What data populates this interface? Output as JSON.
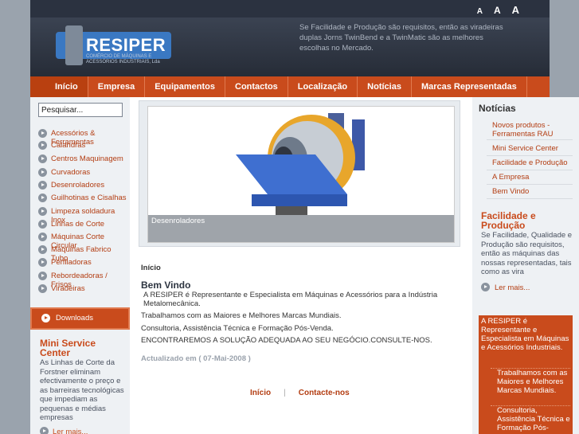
{
  "header": {
    "font_sizes": [
      "A",
      "A",
      "A"
    ],
    "logo_text": "RESIPER",
    "logo_sub": "COMÉRCIO DE MÁQUINAS E ACESSÓRIOS INDUSTRIAIS, Lda",
    "tagline": "Se Facilidade e Produção são requisitos, então as viradeiras duplas Jorns TwinBend e a TwinMatic são as melhores escolhas no Mercado."
  },
  "nav": [
    "Início",
    "Empresa",
    "Equipamentos",
    "Contactos",
    "Localização",
    "Notícias",
    "Marcas Representadas"
  ],
  "left": {
    "search_value": "Pesquisar...",
    "menu": [
      "Acessórios & Ferramentas",
      "Calandras",
      "Centros Maquinagem",
      "Curvadoras",
      "Desenroladores",
      "Guilhotinas e Cisalhas",
      "Limpeza soldadura Inox",
      "Linhas de Corte",
      "Máquinas Corte Circular",
      "Máquinas Fabrico Tubo",
      "Perfiladoras",
      "Rebordeadoras / Frisos",
      "Viradeiras"
    ],
    "downloads": "Downloads",
    "msc_title": "Mini Service Center",
    "msc_text": "As Linhas de Corte da Forstner eliminam efectivamente o preço e as barreiras tecnológicas que impediam as pequenas e médias empresas",
    "msc_more": "Ler mais..."
  },
  "center": {
    "banner_caption": "Desenroladores",
    "breadcrumb": "Início",
    "welcome_title": "Bem Vindo",
    "welcome_paragraphs": [
      "A RESIPER é Representante e Especialista em Máquinas e Acessórios para a Indústria Metalomecânica.",
      "Trabalhamos com as Maiores e Melhores Marcas Mundiais.",
      "Consultoria, Assistência Técnica e Formação Pós-Venda.",
      "ENCONTRAREMOS A SOLUÇÃO ADEQUADA AO SEU NEGÓCIO.CONSULTE-NOS."
    ],
    "updated": "Actualizado em ( 07-Mai-2008 )",
    "footer_links": [
      "Início",
      "|",
      "Contacte-nos"
    ]
  },
  "right": {
    "news_title": "Notícias",
    "news": [
      "Novos produtos - Ferramentas RAU",
      "Mini Service Center",
      "Facilidade e Produção",
      "A Empresa",
      "Bem Vindo"
    ],
    "fp_title": "Facilidade e Produção",
    "fp_text": "Se Facilidade, Qualidade e Produção são requisitos, então as máquinas das nossas representadas, tais como as vira",
    "fp_more": "Ler mais...",
    "promo_head": "A RESIPER é Representante e Especialista em Máquinas e Acessórios Industriais.",
    "promo_items": [
      "Trabalhamos com as Maiores e Melhores Marcas Mundiais.",
      "Consultoria, Assistência Técnica e Formação Pós-"
    ]
  },
  "colors": {
    "accent": "#c94b1c",
    "header": "#2b3240",
    "sidebar": "#eef1f4"
  }
}
